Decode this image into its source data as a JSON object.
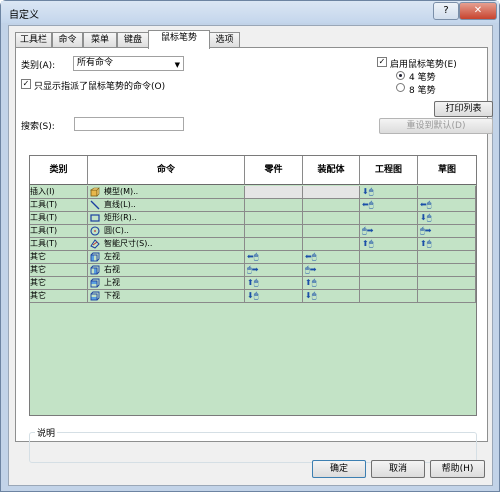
{
  "window": {
    "title": "自定义",
    "help": "?",
    "close": "✕"
  },
  "tabs": [
    {
      "label": "工具栏",
      "active": false
    },
    {
      "label": "命令",
      "active": false
    },
    {
      "label": "菜单",
      "active": false
    },
    {
      "label": "键盘",
      "active": false
    },
    {
      "label": "鼠标笔势",
      "active": true
    },
    {
      "label": "选项",
      "active": false
    }
  ],
  "category": {
    "label": "类别(A):",
    "value": "所有命令"
  },
  "only_assigned": {
    "label": "只显示指派了鼠标笔势的命令(O)",
    "checked": true
  },
  "search": {
    "label": "搜索(S):",
    "value": ""
  },
  "enable": {
    "label": "启用鼠标笔势(E)",
    "checked": true
  },
  "gestures": [
    {
      "label": "4 笔势",
      "selected": true
    },
    {
      "label": "8 笔势",
      "selected": false
    }
  ],
  "print_button": "打印列表(P)...",
  "reset_button": "重设到默认(D)",
  "table": {
    "headers": [
      "类别",
      "命令",
      "零件",
      "装配体",
      "工程图",
      "草图"
    ],
    "rows": [
      {
        "category": "插入(I)",
        "icon": "model-icon",
        "command": "模型(M)..",
        "part": "",
        "assembly": "",
        "drawing": "⬇🖱",
        "sketch": ""
      },
      {
        "category": "工具(T)",
        "icon": "line-icon",
        "command": "直线(L)..",
        "part": "",
        "assembly": "",
        "drawing": "⬅🖱",
        "sketch": "⬅🖱"
      },
      {
        "category": "工具(T)",
        "icon": "rectangle-icon",
        "command": "矩形(R)..",
        "part": "",
        "assembly": "",
        "drawing": "",
        "sketch": "⬇🖱"
      },
      {
        "category": "工具(T)",
        "icon": "circle-icon",
        "command": "圆(C)..",
        "part": "",
        "assembly": "",
        "drawing": "🖱➡",
        "sketch": "🖱➡"
      },
      {
        "category": "工具(T)",
        "icon": "smart-dimension-icon",
        "command": "智能尺寸(S)..",
        "part": "",
        "assembly": "",
        "drawing": "⬆🖱",
        "sketch": "⬆🖱"
      },
      {
        "category": "其它",
        "icon": "left-view-icon",
        "command": "左视",
        "part": "⬅🖱",
        "assembly": "⬅🖱",
        "drawing": "",
        "sketch": ""
      },
      {
        "category": "其它",
        "icon": "right-view-icon",
        "command": "右视",
        "part": "🖱➡",
        "assembly": "🖱➡",
        "drawing": "",
        "sketch": ""
      },
      {
        "category": "其它",
        "icon": "top-view-icon",
        "command": "上视",
        "part": "⬆🖱",
        "assembly": "⬆🖱",
        "drawing": "",
        "sketch": ""
      },
      {
        "category": "其它",
        "icon": "bottom-view-icon",
        "command": "下视",
        "part": "⬇🖱",
        "assembly": "⬇🖱",
        "drawing": "",
        "sketch": ""
      }
    ]
  },
  "description": {
    "label": "说明",
    "text": ""
  },
  "buttons": {
    "ok": "确定",
    "cancel": "取消",
    "help": "帮助(H)"
  },
  "colors": {
    "grid_bg": "#c3e3c6",
    "gesture_blue": "#1a4fa8"
  }
}
